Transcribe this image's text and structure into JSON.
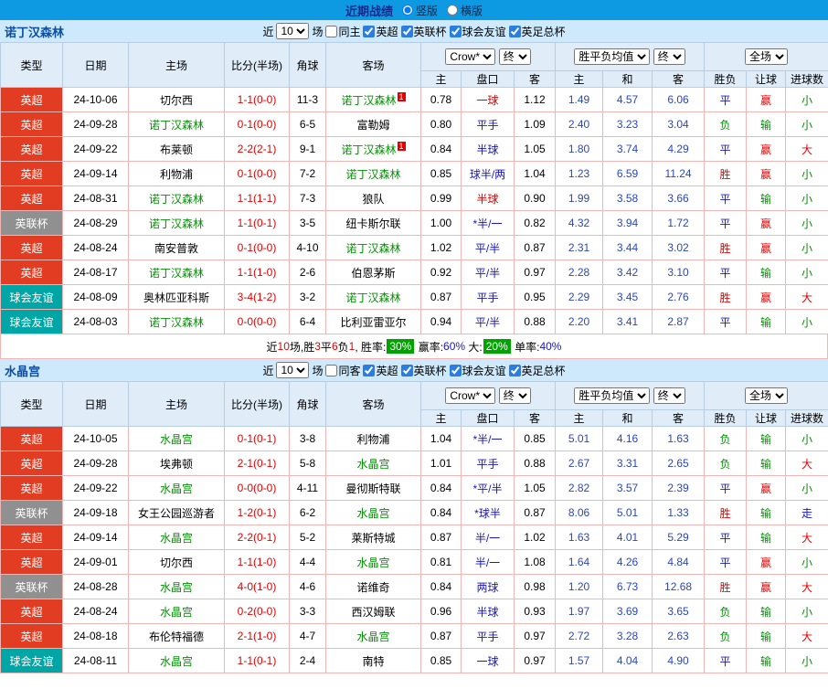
{
  "topbar": {
    "title": "近期战绩",
    "layouts": [
      {
        "label": "竖版",
        "checked": "checked"
      },
      {
        "label": "横版"
      }
    ]
  },
  "colors": {
    "accent_bar": "#0e9ae2",
    "epl_badge": "#e23d23",
    "league_cup_badge": "#909090",
    "friendly_badge": "#00a6a6",
    "win_text": "#e60000",
    "draw_text": "#1515c8",
    "loss_text": "#009100",
    "rate_badge": "#00a400"
  },
  "columns": {
    "type": "类型",
    "date": "日期",
    "home": "主场",
    "score": "比分(半场)",
    "corner": "角球",
    "away": "客场",
    "odds_home": "主",
    "handicap": "盘口",
    "odds_away": "客",
    "mean_home": "主",
    "mean_draw": "和",
    "mean_away": "客",
    "result": "胜负",
    "handicap_result": "让球",
    "goals": "进球数"
  },
  "sections": [
    {
      "team": "诺丁汉森林",
      "filter": {
        "near_label": "近",
        "count": "10",
        "unit_label": "场",
        "same": {
          "label": "同主"
        },
        "leagues": [
          {
            "label": "英超",
            "checked": "checked"
          },
          {
            "label": "英联杯",
            "checked": "checked"
          },
          {
            "label": "球会友谊",
            "checked": "checked"
          },
          {
            "label": "英足总杯",
            "checked": "checked"
          }
        ]
      },
      "table": {
        "selects": {
          "bookmaker": "Crow*",
          "odds_stage": "终",
          "mean_type": "胜平负均值",
          "mean_stage": "终",
          "scope": "全场"
        },
        "rows": [
          {
            "type": "英超",
            "date": "24-10-06",
            "home": "切尔西",
            "score": "1-1(0-0)",
            "corner": "11-3",
            "away": "诺丁汉森林",
            "away_note": "1",
            "odds_home": "0.78",
            "handicap": "一球",
            "handicap_red": true,
            "odds_away": "1.12",
            "mean_home": "1.49",
            "mean_draw": "4.57",
            "mean_away": "6.06",
            "result": "平",
            "handicap_result": "赢",
            "goals": "小"
          },
          {
            "type": "英超",
            "date": "24-09-28",
            "home": "诺丁汉森林",
            "score": "0-1(0-0)",
            "corner": "6-5",
            "away": "富勒姆",
            "odds_home": "0.80",
            "handicap": "平手",
            "odds_away": "1.09",
            "mean_home": "2.40",
            "mean_draw": "3.23",
            "mean_away": "3.04",
            "result": "负",
            "handicap_result": "输",
            "goals": "小"
          },
          {
            "type": "英超",
            "date": "24-09-22",
            "home": "布莱顿",
            "score": "2-2(2-1)",
            "corner": "9-1",
            "away": "诺丁汉森林",
            "away_note": "1",
            "odds_home": "0.84",
            "handicap": "半球",
            "odds_away": "1.05",
            "mean_home": "1.80",
            "mean_draw": "3.74",
            "mean_away": "4.29",
            "result": "平",
            "handicap_result": "赢",
            "goals": "大"
          },
          {
            "type": "英超",
            "date": "24-09-14",
            "home": "利物浦",
            "score": "0-1(0-0)",
            "corner": "7-2",
            "away": "诺丁汉森林",
            "odds_home": "0.85",
            "handicap": "球半/两",
            "odds_away": "1.04",
            "mean_home": "1.23",
            "mean_draw": "6.59",
            "mean_away": "11.24",
            "result": "胜",
            "handicap_result": "赢",
            "goals": "小"
          },
          {
            "type": "英超",
            "date": "24-08-31",
            "home": "诺丁汉森林",
            "score": "1-1(1-1)",
            "corner": "7-3",
            "away": "狼队",
            "odds_home": "0.99",
            "handicap": "半球",
            "handicap_red": true,
            "odds_away": "0.90",
            "mean_home": "1.99",
            "mean_draw": "3.58",
            "mean_away": "3.66",
            "result": "平",
            "handicap_result": "输",
            "goals": "小"
          },
          {
            "type": "英联杯",
            "date": "24-08-29",
            "home": "诺丁汉森林",
            "score": "1-1(0-1)",
            "corner": "3-5",
            "away": "纽卡斯尔联",
            "odds_home": "1.00",
            "handicap": "*半/一",
            "odds_away": "0.82",
            "mean_home": "4.32",
            "mean_draw": "3.94",
            "mean_away": "1.72",
            "result": "平",
            "handicap_result": "赢",
            "goals": "小"
          },
          {
            "type": "英超",
            "date": "24-08-24",
            "home": "南安普敦",
            "score": "0-1(0-0)",
            "corner": "4-10",
            "away": "诺丁汉森林",
            "odds_home": "1.02",
            "handicap": "平/半",
            "odds_away": "0.87",
            "mean_home": "2.31",
            "mean_draw": "3.44",
            "mean_away": "3.02",
            "result": "胜",
            "handicap_result": "赢",
            "goals": "小"
          },
          {
            "type": "英超",
            "date": "24-08-17",
            "home": "诺丁汉森林",
            "score": "1-1(1-0)",
            "corner": "2-6",
            "away": "伯恩茅斯",
            "odds_home": "0.92",
            "handicap": "平/半",
            "odds_away": "0.97",
            "mean_home": "2.28",
            "mean_draw": "3.42",
            "mean_away": "3.10",
            "result": "平",
            "handicap_result": "输",
            "goals": "小"
          },
          {
            "type": "球会友谊",
            "date": "24-08-09",
            "home": "奥林匹亚科斯",
            "score": "3-4(1-2)",
            "corner": "3-2",
            "away": "诺丁汉森林",
            "odds_home": "0.87",
            "handicap": "平手",
            "odds_away": "0.95",
            "mean_home": "2.29",
            "mean_draw": "3.45",
            "mean_away": "2.76",
            "result": "胜",
            "handicap_result": "赢",
            "goals": "大"
          },
          {
            "type": "球会友谊",
            "date": "24-08-03",
            "home": "诺丁汉森林",
            "score": "0-0(0-0)",
            "corner": "6-4",
            "away": "比利亚雷亚尔",
            "odds_home": "0.94",
            "handicap": "平/半",
            "odds_away": "0.88",
            "mean_home": "2.20",
            "mean_draw": "3.41",
            "mean_away": "2.87",
            "result": "平",
            "handicap_result": "输",
            "goals": "小"
          }
        ]
      },
      "summary": [
        {
          "text": "近"
        },
        {
          "text": "10",
          "color": "red"
        },
        {
          "text": "场,胜"
        },
        {
          "text": "3",
          "color": "red"
        },
        {
          "text": "平"
        },
        {
          "text": "6",
          "color": "red"
        },
        {
          "text": "负"
        },
        {
          "text": "1",
          "color": "red"
        },
        {
          "text": ", 胜率:"
        },
        {
          "text": "30%",
          "badge": "green"
        },
        {
          "text": " 赢率:"
        },
        {
          "text": "60%",
          "color": "blue"
        },
        {
          "text": " 大:"
        },
        {
          "text": "20%",
          "badge": "green"
        },
        {
          "text": " 单率:"
        },
        {
          "text": "40%",
          "color": "blue"
        }
      ]
    },
    {
      "team": "水晶宫",
      "filter": {
        "near_label": "近",
        "count": "10",
        "unit_label": "场",
        "same": {
          "label": "同客"
        },
        "leagues": [
          {
            "label": "英超",
            "checked": "checked"
          },
          {
            "label": "英联杯",
            "checked": "checked"
          },
          {
            "label": "球会友谊",
            "checked": "checked"
          },
          {
            "label": "英足总杯",
            "checked": "checked"
          }
        ]
      },
      "table": {
        "selects": {
          "bookmaker": "Crow*",
          "odds_stage": "终",
          "mean_type": "胜平负均值",
          "mean_stage": "终",
          "scope": "全场"
        },
        "rows": [
          {
            "type": "英超",
            "date": "24-10-05",
            "home": "水晶宫",
            "score": "0-1(0-1)",
            "corner": "3-8",
            "away": "利物浦",
            "odds_home": "1.04",
            "handicap": "*半/一",
            "odds_away": "0.85",
            "mean_home": "5.01",
            "mean_draw": "4.16",
            "mean_away": "1.63",
            "result": "负",
            "handicap_result": "输",
            "goals": "小"
          },
          {
            "type": "英超",
            "date": "24-09-28",
            "home": "埃弗顿",
            "score": "2-1(0-1)",
            "corner": "5-8",
            "away": "水晶宫",
            "odds_home": "1.01",
            "handicap": "平手",
            "odds_away": "0.88",
            "mean_home": "2.67",
            "mean_draw": "3.31",
            "mean_away": "2.65",
            "result": "负",
            "handicap_result": "输",
            "goals": "大"
          },
          {
            "type": "英超",
            "date": "24-09-22",
            "home": "水晶宫",
            "score": "0-0(0-0)",
            "corner": "4-11",
            "away": "曼彻斯特联",
            "odds_home": "0.84",
            "handicap": "*平/半",
            "odds_away": "1.05",
            "mean_home": "2.82",
            "mean_draw": "3.57",
            "mean_away": "2.39",
            "result": "平",
            "handicap_result": "赢",
            "goals": "小"
          },
          {
            "type": "英联杯",
            "date": "24-09-18",
            "home": "女王公园巡游者",
            "score": "1-2(0-1)",
            "corner": "6-2",
            "away": "水晶宫",
            "odds_home": "0.84",
            "handicap": "*球半",
            "odds_away": "0.87",
            "mean_home": "8.06",
            "mean_draw": "5.01",
            "mean_away": "1.33",
            "result": "胜",
            "handicap_result": "输",
            "goals": "走"
          },
          {
            "type": "英超",
            "date": "24-09-14",
            "home": "水晶宫",
            "score": "2-2(0-1)",
            "corner": "5-2",
            "away": "莱斯特城",
            "odds_home": "0.87",
            "handicap": "半/一",
            "odds_away": "1.02",
            "mean_home": "1.63",
            "mean_draw": "4.01",
            "mean_away": "5.29",
            "result": "平",
            "handicap_result": "输",
            "goals": "大"
          },
          {
            "type": "英超",
            "date": "24-09-01",
            "home": "切尔西",
            "score": "1-1(1-0)",
            "corner": "4-4",
            "away": "水晶宫",
            "odds_home": "0.81",
            "handicap": "半/一",
            "odds_away": "1.08",
            "mean_home": "1.64",
            "mean_draw": "4.26",
            "mean_away": "4.84",
            "result": "平",
            "handicap_result": "赢",
            "goals": "小"
          },
          {
            "type": "英联杯",
            "date": "24-08-28",
            "home": "水晶宫",
            "score": "4-0(1-0)",
            "corner": "4-6",
            "away": "诺维奇",
            "odds_home": "0.84",
            "handicap": "两球",
            "odds_away": "0.98",
            "mean_home": "1.20",
            "mean_draw": "6.73",
            "mean_away": "12.68",
            "result": "胜",
            "handicap_result": "赢",
            "goals": "大"
          },
          {
            "type": "英超",
            "date": "24-08-24",
            "home": "水晶宫",
            "score": "0-2(0-0)",
            "corner": "3-3",
            "away": "西汉姆联",
            "odds_home": "0.96",
            "handicap": "半球",
            "odds_away": "0.93",
            "mean_home": "1.97",
            "mean_draw": "3.69",
            "mean_away": "3.65",
            "result": "负",
            "handicap_result": "输",
            "goals": "小"
          },
          {
            "type": "英超",
            "date": "24-08-18",
            "home": "布伦特福德",
            "score": "2-1(1-0)",
            "corner": "4-7",
            "away": "水晶宫",
            "odds_home": "0.87",
            "handicap": "平手",
            "odds_away": "0.97",
            "mean_home": "2.72",
            "mean_draw": "3.28",
            "mean_away": "2.63",
            "result": "负",
            "handicap_result": "输",
            "goals": "大"
          },
          {
            "type": "球会友谊",
            "date": "24-08-11",
            "home": "水晶宫",
            "score": "1-1(0-1)",
            "corner": "2-4",
            "away": "南特",
            "odds_home": "0.85",
            "handicap": "一球",
            "odds_away": "0.97",
            "mean_home": "1.57",
            "mean_draw": "4.04",
            "mean_away": "4.90",
            "result": "平",
            "handicap_result": "输",
            "goals": "小"
          }
        ]
      }
    }
  ]
}
